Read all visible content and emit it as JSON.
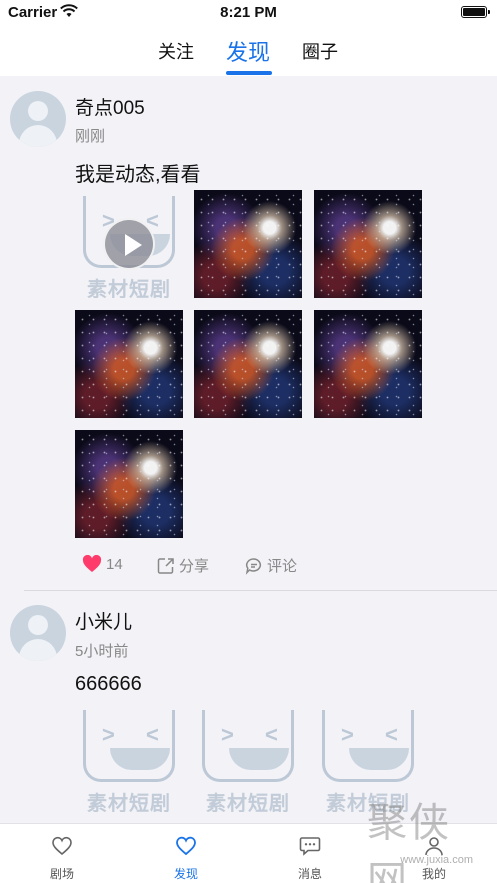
{
  "status_bar": {
    "carrier": "Carrier",
    "time": "8:21 PM"
  },
  "top_tabs": [
    {
      "label": "关注",
      "active": false
    },
    {
      "label": "发现",
      "active": true
    },
    {
      "label": "圈子",
      "active": false
    }
  ],
  "posts": [
    {
      "username": "奇点005",
      "time": "刚刚",
      "content": "我是动态,看看",
      "media": [
        "video",
        "image",
        "image",
        "image",
        "image",
        "image",
        "image"
      ],
      "likes": "14",
      "share_label": "分享",
      "comment_label": "评论"
    },
    {
      "username": "小米儿",
      "time": "5小时前",
      "content": "666666",
      "media": [
        "placeholder",
        "placeholder",
        "placeholder"
      ]
    }
  ],
  "placeholder_text": "素材短剧",
  "bottom_nav": [
    {
      "label": "剧场",
      "icon": "heart-outline-icon",
      "active": false
    },
    {
      "label": "发现",
      "icon": "heart-outline-icon",
      "active": true
    },
    {
      "label": "消息",
      "icon": "chat-bubble-icon",
      "active": false
    },
    {
      "label": "我的",
      "icon": "person-icon",
      "active": false
    }
  ],
  "watermark": {
    "text": "聚侠网",
    "url": "www.juxia.com"
  },
  "colors": {
    "accent": "#1a73e8",
    "like": "#ff3b6b",
    "background": "#f2f2f7"
  }
}
